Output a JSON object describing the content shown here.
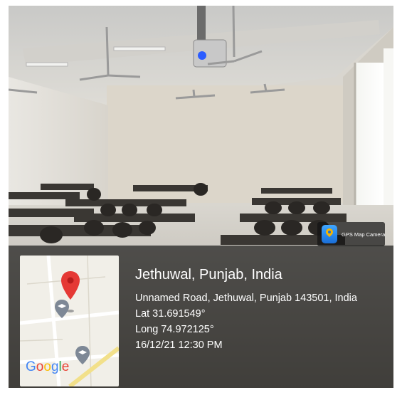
{
  "badge": {
    "label": "GPS Map Camera",
    "icon": "map-pin-icon",
    "icon_color": "#1a6fd8",
    "pin_color": "#f5b400"
  },
  "location": {
    "title": "Jethuwal, Punjab, India",
    "address": "Unnamed Road, Jethuwal, Punjab 143501, India",
    "latitude": "Lat 31.691549°",
    "longitude": "Long 74.972125°",
    "datetime": "16/12/21 12:30 PM"
  },
  "map": {
    "brand_label": "Google",
    "marker_color": "#e53935",
    "pin_icon": "location-marker-icon",
    "place_icons": [
      "school-icon",
      "school-icon"
    ]
  }
}
